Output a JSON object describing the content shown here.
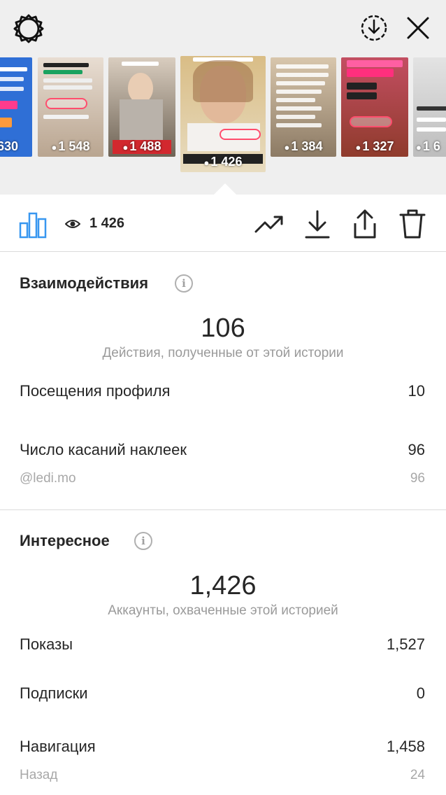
{
  "header": {
    "icons": [
      "gear-icon",
      "download-circle-icon",
      "close-icon"
    ]
  },
  "story_thumbnails": [
    {
      "count": "630",
      "texts": [
        "м твоя",
        "дорежную",
        "того, что",
        "шь!?",
        "НЕТ"
      ],
      "color": "#2f6fd6"
    },
    {
      "count": "1 548",
      "texts": [
        "@ledi.mo"
      ],
      "color": "#d9c9b8"
    },
    {
      "count": "1 488",
      "texts": [
        "Включи звук"
      ],
      "color": "#8f7f6e"
    },
    {
      "count": "1 426",
      "texts": [
        "@ledi.mo"
      ],
      "color": "#d8b98a",
      "active": true
    },
    {
      "count": "1 384",
      "texts": [
        "Бесплатные консультации по похудению, лечению акне и уходу за волосами в аккаунте"
      ],
      "color": "#c9b49a"
    },
    {
      "count": "1 327",
      "texts": [
        "для ЖЕНСКОЙ",
        "КРАСОТЫ",
        "СахЗам",
        "ОПАСЕН",
        "@ledi.mo"
      ],
      "color": "#b0483f"
    },
    {
      "count": "1 6",
      "texts": [
        "Доброе утро"
      ],
      "color": "#cfcfcf"
    }
  ],
  "toolbar": {
    "views": "1 426",
    "icons": [
      "bar-chart-icon",
      "eye-icon",
      "trending-icon",
      "download-icon",
      "share-icon",
      "trash-icon"
    ]
  },
  "interactions": {
    "title": "Взаимодействия",
    "info": "i",
    "total": "106",
    "caption": "Действия, полученные от этой истории",
    "rows": [
      {
        "label": "Посещения профиля",
        "value": "10"
      },
      {
        "label": "Число касаний наклеек",
        "value": "96"
      }
    ],
    "sub": {
      "label": "@ledi.mo",
      "value": "96"
    }
  },
  "discovery": {
    "title": "Интересное",
    "info": "i",
    "total": "1,426",
    "caption": "Аккаунты, охваченные этой историей",
    "rows": [
      {
        "label": "Показы",
        "value": "1,527"
      },
      {
        "label": "Подписки",
        "value": "0"
      },
      {
        "label": "Навигация",
        "value": "1,458"
      }
    ],
    "sub": {
      "label": "Назад",
      "value": "24"
    }
  },
  "colors": {
    "accent": "#3897f0",
    "text": "#262626",
    "muted": "#9a9a9a",
    "strip_bg": "#efefef"
  }
}
